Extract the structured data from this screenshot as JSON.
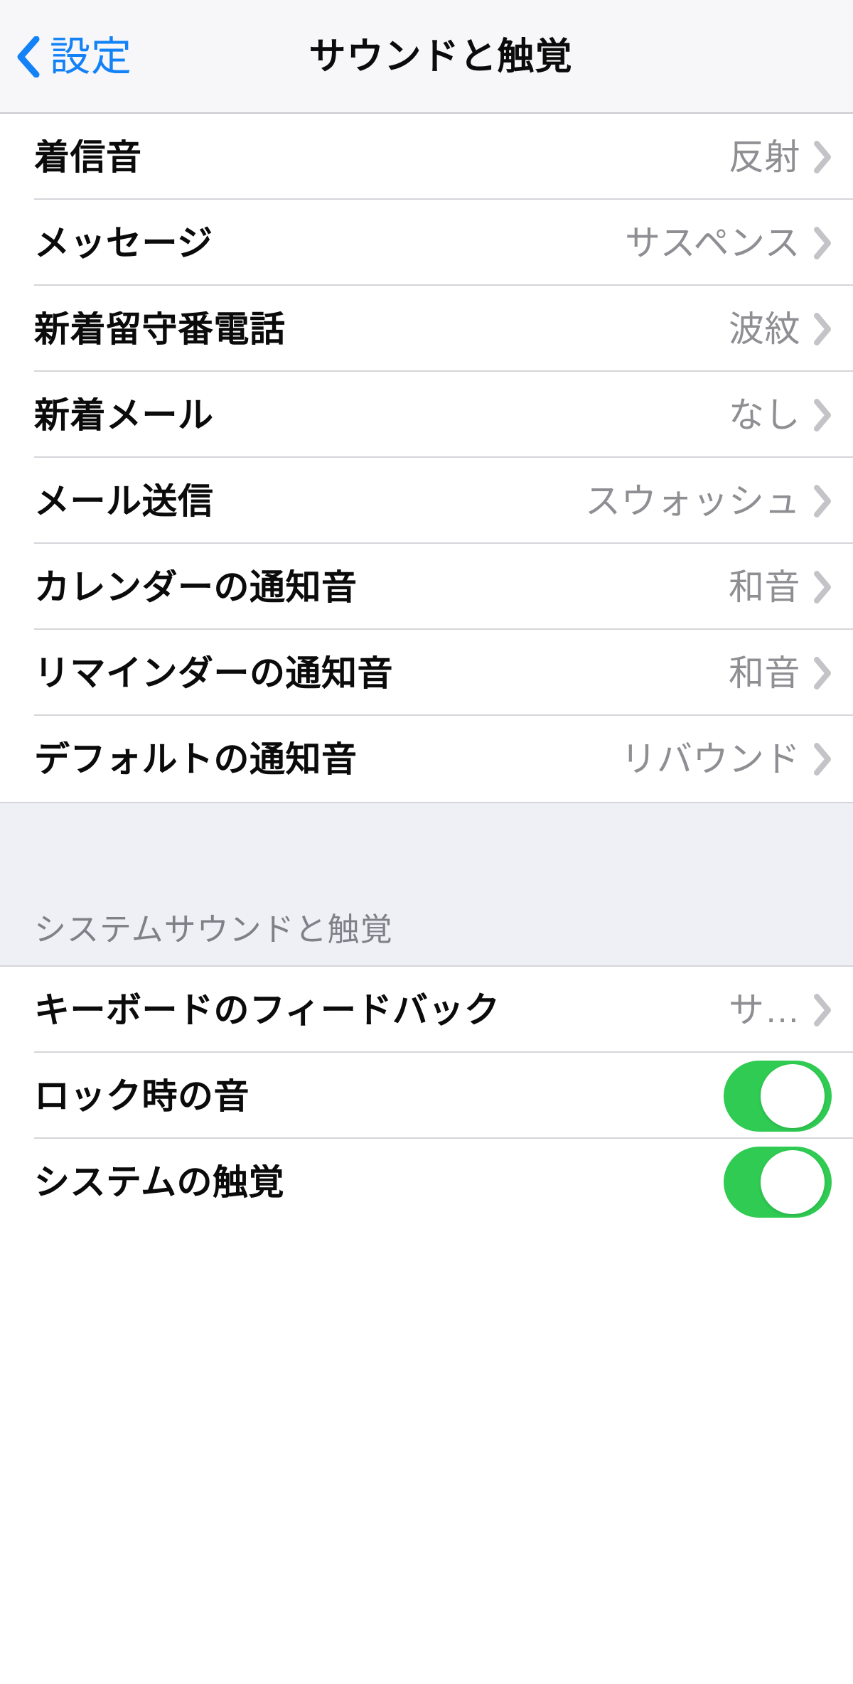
{
  "navbar": {
    "back_label": "設定",
    "back_icon": "chevron-left-icon",
    "title": "サウンドと触覚",
    "accent_color": "#1382f6",
    "background_color": "#f7f7fa"
  },
  "colors": {
    "row_background": "#ffffff",
    "separator": "#d6d6da",
    "section_background": "#eff0f5",
    "label_text": "#0b0b0c",
    "value_text": "#8e8e93",
    "section_text": "#7f8189",
    "chevron": "#c4c4c8",
    "toggle_on": "#2fcb52",
    "toggle_knob": "#ffffff"
  },
  "sections": [
    {
      "id": "sounds-and-vibration-patterns",
      "header": null,
      "rows": [
        {
          "id": "ringtone",
          "label": "着信音",
          "value": "反射",
          "type": "disclosure",
          "accessory": "chevron-right-icon"
        },
        {
          "id": "text-tone",
          "label": "メッセージ",
          "value": "サスペンス",
          "type": "disclosure",
          "accessory": "chevron-right-icon"
        },
        {
          "id": "new-voicemail",
          "label": "新着留守番電話",
          "value": "波紋",
          "type": "disclosure",
          "accessory": "chevron-right-icon"
        },
        {
          "id": "new-mail",
          "label": "新着メール",
          "value": "なし",
          "type": "disclosure",
          "accessory": "chevron-right-icon"
        },
        {
          "id": "sent-mail",
          "label": "メール送信",
          "value": "スウォッシュ",
          "type": "disclosure",
          "accessory": "chevron-right-icon"
        },
        {
          "id": "calendar-alerts",
          "label": "カレンダーの通知音",
          "value": "和音",
          "type": "disclosure",
          "accessory": "chevron-right-icon"
        },
        {
          "id": "reminder-alerts",
          "label": "リマインダーの通知音",
          "value": "和音",
          "type": "disclosure",
          "accessory": "chevron-right-icon"
        },
        {
          "id": "default-alerts",
          "label": "デフォルトの通知音",
          "value": "リバウンド",
          "type": "disclosure",
          "accessory": "chevron-right-icon"
        }
      ]
    },
    {
      "id": "system-sounds-and-haptics",
      "header": "システムサウンドと触覚",
      "rows": [
        {
          "id": "keyboard-feedback",
          "label": "キーボードのフィードバック",
          "value": "サ…",
          "type": "disclosure",
          "accessory": "chevron-right-icon"
        },
        {
          "id": "lock-sound",
          "label": "ロック時の音",
          "value": null,
          "type": "toggle",
          "toggle_state": "on"
        },
        {
          "id": "system-haptics",
          "label": "システムの触覚",
          "value": null,
          "type": "toggle",
          "toggle_state": "on"
        }
      ]
    }
  ]
}
